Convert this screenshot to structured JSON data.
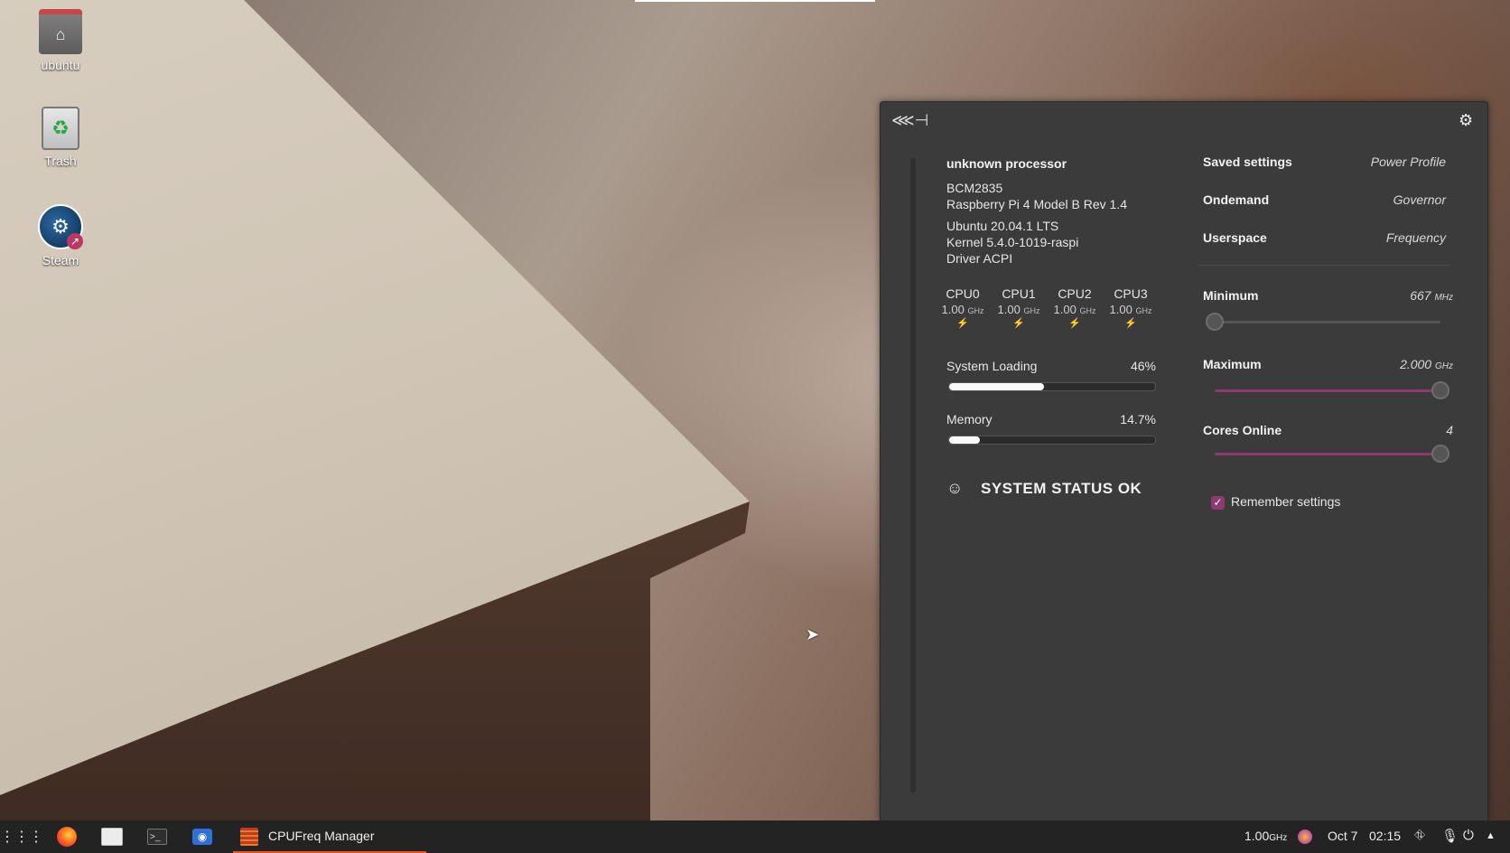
{
  "desktop": {
    "icons": [
      {
        "label": "ubuntu",
        "icon": "home-folder-icon"
      },
      {
        "label": "Trash",
        "icon": "trash-icon"
      },
      {
        "label": "Steam",
        "icon": "steam-icon"
      }
    ]
  },
  "cpufreq": {
    "logo_icon": "fish-skeleton-logo-icon",
    "settings_icon": "gear-icon",
    "processor_name": "unknown processor",
    "info_lines": [
      "BCM2835",
      "Raspberry Pi 4 Model B Rev 1.4"
    ],
    "system_lines": [
      "Ubuntu 20.04.1 LTS",
      "Kernel 5.4.0-1019-raspi",
      "Driver ACPI"
    ],
    "cpus": [
      {
        "name": "CPU0",
        "freq": "1.00",
        "unit": "GHz",
        "icon": "⚡"
      },
      {
        "name": "CPU1",
        "freq": "1.00",
        "unit": "GHz",
        "icon": "⚡"
      },
      {
        "name": "CPU2",
        "freq": "1.00",
        "unit": "GHz",
        "icon": "⚡"
      },
      {
        "name": "CPU3",
        "freq": "1.00",
        "unit": "GHz",
        "icon": "⚡"
      }
    ],
    "system_loading": {
      "label": "System Loading",
      "value": "46%",
      "fraction": 0.46
    },
    "memory": {
      "label": "Memory",
      "value": "14.7%",
      "fraction": 0.147
    },
    "status": {
      "icon": "☺",
      "text": "SYSTEM STATUS OK"
    },
    "settings_rows": [
      {
        "label": "Saved settings",
        "value": "Power Profile"
      },
      {
        "label": "Ondemand",
        "value": "Governor"
      },
      {
        "label": "Userspace",
        "value": "Frequency"
      }
    ],
    "minimum": {
      "label": "Minimum",
      "value": "667",
      "unit": "MHz",
      "fraction": 0.0
    },
    "maximum": {
      "label": "Maximum",
      "value": "2.000",
      "unit": "GHz",
      "fraction": 1.0
    },
    "cores_online": {
      "label": "Cores Online",
      "value": "4",
      "fraction": 1.0
    },
    "remember": {
      "label": "Remember settings",
      "checked": true
    },
    "colors": {
      "accent": "#8e3a6e",
      "panel": "#3b3b3b",
      "meter_fill": "#fafafa"
    }
  },
  "taskbar": {
    "app_grid_icon": "app-grid-icon",
    "launchers": [
      "firefox-icon",
      "files-icon",
      "terminal-icon",
      "screenshot-icon"
    ],
    "active_task": {
      "label": "CPUFreq Manager",
      "icon": "cpufreq-icon"
    },
    "tray": {
      "freq_value": "1.00",
      "freq_unit": "GHz",
      "date": "Oct 7",
      "time": "02:15",
      "icons": [
        "network-icon",
        "microphone-icon",
        "power-icon",
        "chevron-up-icon"
      ]
    },
    "accent": "#e95420"
  }
}
